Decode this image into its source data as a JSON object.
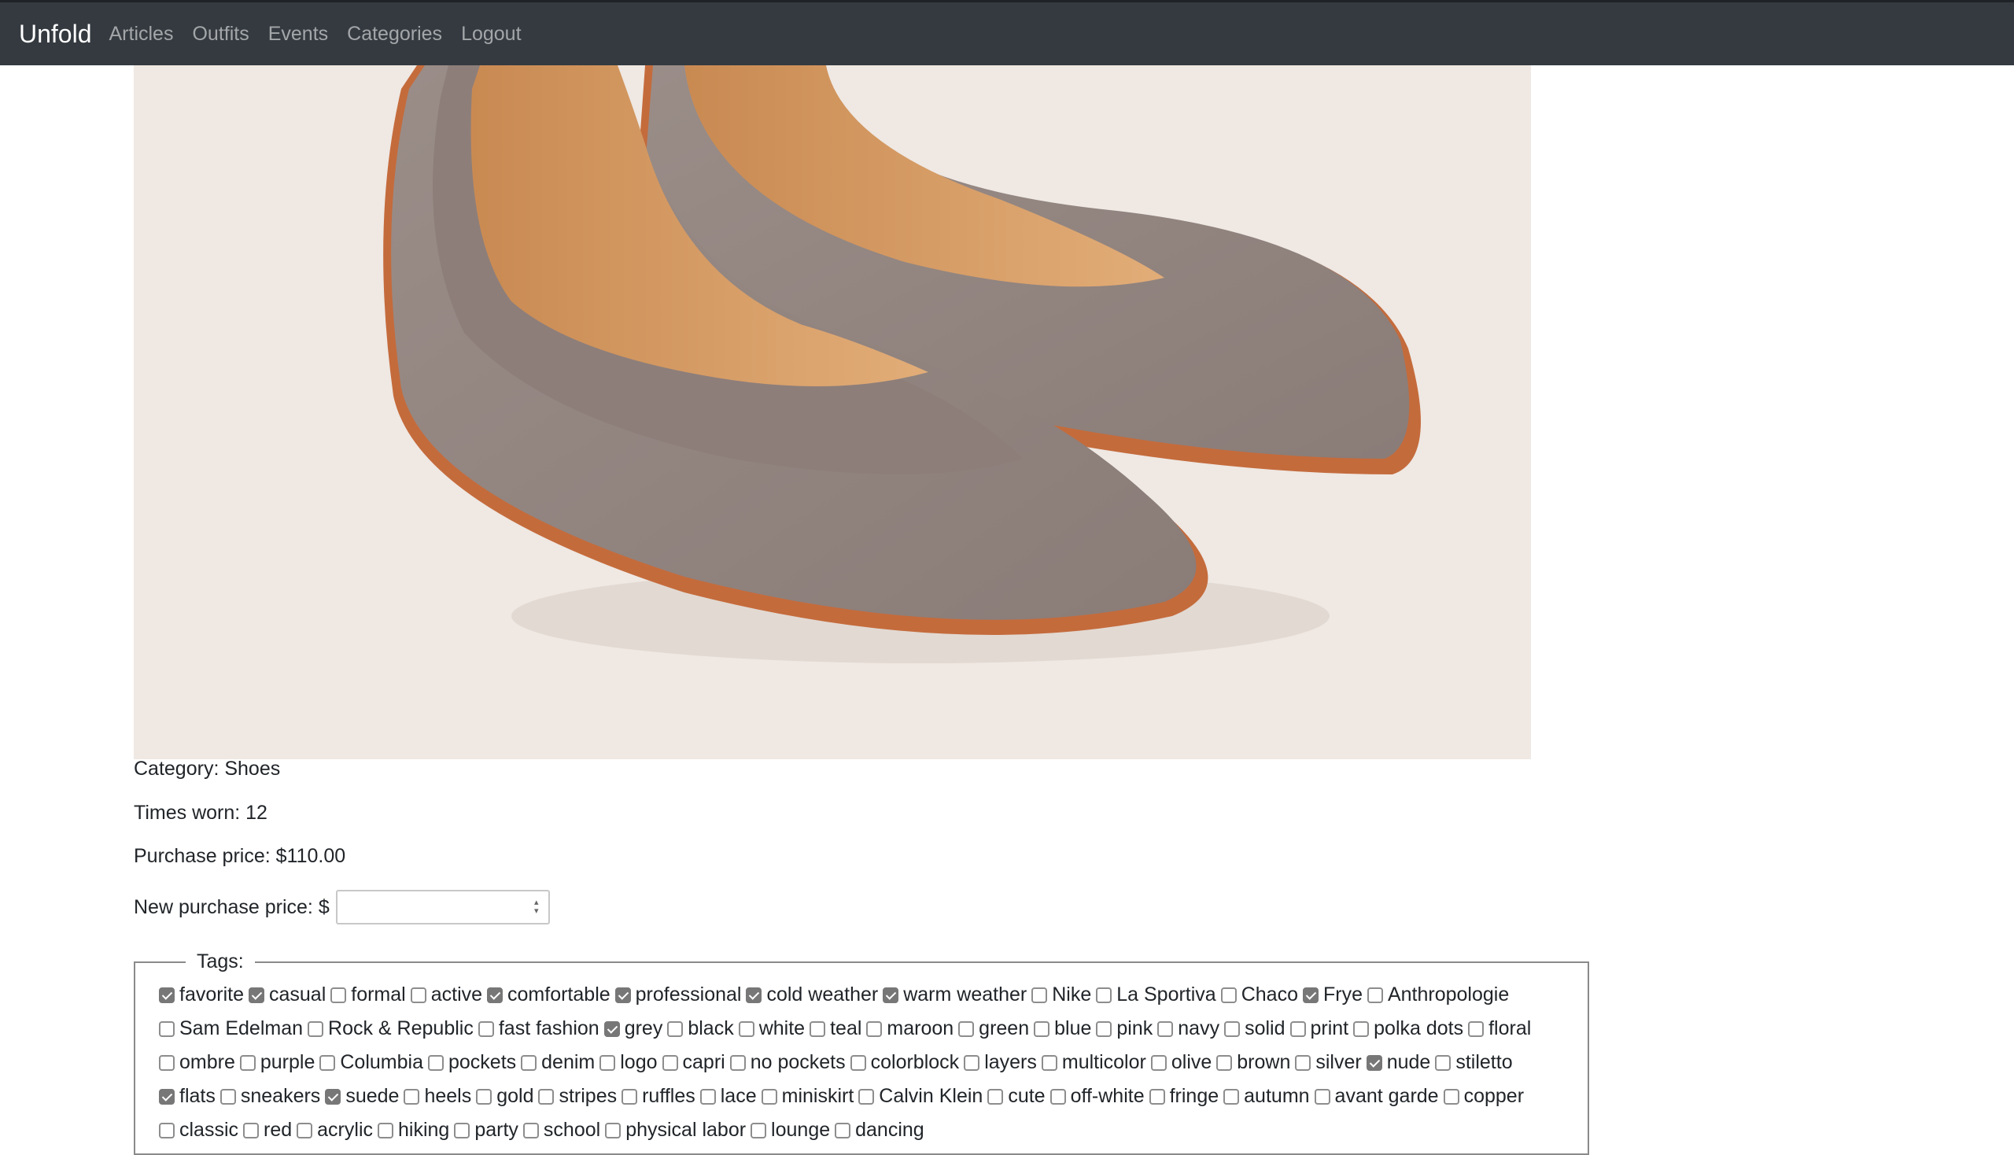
{
  "nav": {
    "brand": "Unfold",
    "links": [
      "Articles",
      "Outfits",
      "Events",
      "Categories",
      "Logout"
    ]
  },
  "image": {
    "description_icon": "shoe-photo"
  },
  "details": {
    "category": "Category: Shoes",
    "times_worn": "Times worn: 12",
    "purchase_price": "Purchase price: $110.00",
    "new_price_label": "New purchase price: $",
    "new_price_value": ""
  },
  "tags": {
    "legend": "Tags:",
    "items": [
      {
        "label": "favorite",
        "checked": true
      },
      {
        "label": "casual",
        "checked": true
      },
      {
        "label": "formal",
        "checked": false
      },
      {
        "label": "active",
        "checked": false
      },
      {
        "label": "comfortable",
        "checked": true
      },
      {
        "label": "professional",
        "checked": true
      },
      {
        "label": "cold weather",
        "checked": true
      },
      {
        "label": "warm weather",
        "checked": true
      },
      {
        "label": "Nike",
        "checked": false
      },
      {
        "label": "La Sportiva",
        "checked": false
      },
      {
        "label": "Chaco",
        "checked": false
      },
      {
        "label": "Frye",
        "checked": true
      },
      {
        "label": "Anthropologie",
        "checked": false
      },
      {
        "label": "Sam Edelman",
        "checked": false
      },
      {
        "label": "Rock & Republic",
        "checked": false
      },
      {
        "label": "fast fashion",
        "checked": false
      },
      {
        "label": "grey",
        "checked": true
      },
      {
        "label": "black",
        "checked": false
      },
      {
        "label": "white",
        "checked": false
      },
      {
        "label": "teal",
        "checked": false
      },
      {
        "label": "maroon",
        "checked": false
      },
      {
        "label": "green",
        "checked": false
      },
      {
        "label": "blue",
        "checked": false
      },
      {
        "label": "pink",
        "checked": false
      },
      {
        "label": "navy",
        "checked": false
      },
      {
        "label": "solid",
        "checked": false
      },
      {
        "label": "print",
        "checked": false
      },
      {
        "label": "polka dots",
        "checked": false
      },
      {
        "label": "floral",
        "checked": false
      },
      {
        "label": "ombre",
        "checked": false
      },
      {
        "label": "purple",
        "checked": false
      },
      {
        "label": "Columbia",
        "checked": false
      },
      {
        "label": "pockets",
        "checked": false
      },
      {
        "label": "denim",
        "checked": false
      },
      {
        "label": "logo",
        "checked": false
      },
      {
        "label": "capri",
        "checked": false
      },
      {
        "label": "no pockets",
        "checked": false
      },
      {
        "label": "colorblock",
        "checked": false
      },
      {
        "label": "layers",
        "checked": false
      },
      {
        "label": "multicolor",
        "checked": false
      },
      {
        "label": "olive",
        "checked": false
      },
      {
        "label": "brown",
        "checked": false
      },
      {
        "label": "silver",
        "checked": false
      },
      {
        "label": "nude",
        "checked": true
      },
      {
        "label": "stiletto",
        "checked": false
      },
      {
        "label": "flats",
        "checked": true
      },
      {
        "label": "sneakers",
        "checked": false
      },
      {
        "label": "suede",
        "checked": true
      },
      {
        "label": "heels",
        "checked": false
      },
      {
        "label": "gold",
        "checked": false
      },
      {
        "label": "stripes",
        "checked": false
      },
      {
        "label": "ruffles",
        "checked": false
      },
      {
        "label": "lace",
        "checked": false
      },
      {
        "label": "miniskirt",
        "checked": false
      },
      {
        "label": "Calvin Klein",
        "checked": false
      },
      {
        "label": "cute",
        "checked": false
      },
      {
        "label": "off-white",
        "checked": false
      },
      {
        "label": "fringe",
        "checked": false
      },
      {
        "label": "autumn",
        "checked": false
      },
      {
        "label": "avant garde",
        "checked": false
      },
      {
        "label": "copper",
        "checked": false
      },
      {
        "label": "classic",
        "checked": false
      },
      {
        "label": "red",
        "checked": false
      },
      {
        "label": "acrylic",
        "checked": false
      },
      {
        "label": "hiking",
        "checked": false
      },
      {
        "label": "party",
        "checked": false
      },
      {
        "label": "school",
        "checked": false
      },
      {
        "label": "physical labor",
        "checked": false
      },
      {
        "label": "lounge",
        "checked": false
      },
      {
        "label": "dancing",
        "checked": false
      }
    ]
  }
}
